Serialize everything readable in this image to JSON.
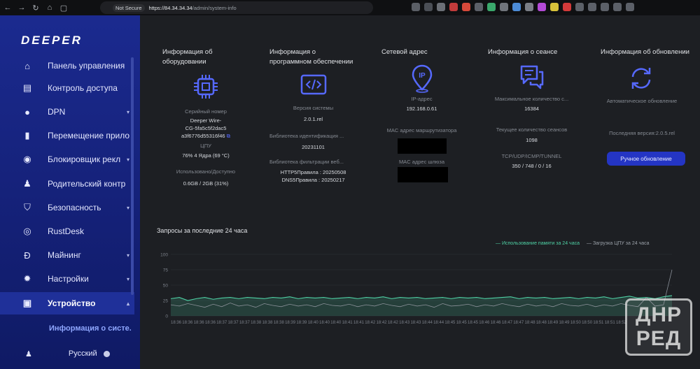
{
  "browser": {
    "security_label": "Not Secure",
    "url_host": "https://84.34.34.34",
    "url_path": "/admin/system-info"
  },
  "sidebar": {
    "logo": "DEEPER",
    "items": [
      {
        "label": "Панель управления",
        "icon": "home-icon"
      },
      {
        "label": "Контроль доступа",
        "icon": "access-control-icon"
      },
      {
        "label": "DPN",
        "icon": "globe-icon"
      },
      {
        "label": "Перемещение прило",
        "icon": "unlock-icon"
      },
      {
        "label": "Блокировщик рекл",
        "icon": "ad-block-icon"
      },
      {
        "label": "Родительский контр",
        "icon": "parental-control-icon"
      },
      {
        "label": "Безопасность",
        "icon": "shield-icon"
      },
      {
        "label": "RustDesk",
        "icon": "rustdesk-icon"
      },
      {
        "label": "Майнинг",
        "icon": "mining-icon"
      },
      {
        "label": "Настройки",
        "icon": "gear-icon"
      },
      {
        "label": "Устройство",
        "icon": "device-icon"
      }
    ],
    "submenu_active": "Информация о систе...",
    "language": "Русский"
  },
  "hardware": {
    "title": "Информация об оборудовании",
    "serial_label": "Серийный номер",
    "serial_value_1": "Deeper Wire-",
    "serial_value_2": "CG-5fa5c5f2dac5",
    "serial_value_3": "a3f6776d55316f46",
    "cpu_label": "ЦПУ",
    "cpu_value": "76% 4 Ядра (69 °C)",
    "usage_label": "Использовано/Доступно",
    "usage_value": "0.6GB / 2GB (31%)"
  },
  "software": {
    "title": "Информация о программном обеспечении",
    "version_label": "Версия системы",
    "version_value": "2.0.1.rel",
    "id_lib_label": "Библиотека идентификация ...",
    "id_lib_value": "20231101",
    "filter_lib_label": "Библиотека фильтрации веб...",
    "filter_http": "HTTP5Правила : 20250508",
    "filter_dns": "DNS5Правила : 20250217"
  },
  "network": {
    "title": "Сетевой адрес",
    "ip_label": "IP-адрес",
    "ip_value": "192.168.0.61",
    "router_mac_label": "MAC адрес маршрутизатора",
    "gateway_mac_label": "MAC адрес шлюза"
  },
  "session": {
    "title": "Информация о сеансе",
    "max_label": "Максимальное количество с...",
    "max_value": "16384",
    "current_label": "Текущее количество сеансов",
    "current_value": "1098",
    "proto_label": "TCP/UDP/ICMP/TUNNEL",
    "proto_value": "350 / 748 / 0 / 16"
  },
  "updates": {
    "title": "Информация об обновлении",
    "auto_label": "Автоматическое обновление",
    "latest_label": "Последняя версия:2.0.5.rel",
    "manual_button": "Ручное обновление"
  },
  "chart_data": {
    "type": "line",
    "title": "Запросы за последние 24 часа",
    "series": [
      {
        "name": "Использование памяти за 24 часа",
        "color": "#4fd1a5",
        "values": [
          28,
          30,
          25,
          28,
          30,
          27,
          29,
          30,
          28,
          30,
          29,
          28,
          30,
          29,
          31,
          28,
          30,
          29,
          30,
          28,
          29,
          30,
          28,
          30,
          29,
          31,
          28,
          30,
          29,
          30,
          28,
          29,
          30,
          28,
          30,
          29,
          30,
          28,
          29,
          30,
          31,
          28,
          30,
          29,
          30,
          28,
          29,
          30,
          28,
          30,
          29,
          31,
          28,
          30,
          32,
          29,
          30,
          28,
          31,
          33
        ]
      },
      {
        "name": "Загрузка ЦПУ за 24 часа",
        "color": "#8a9098",
        "values": [
          18,
          16,
          20,
          17,
          14,
          19,
          15,
          21,
          16,
          18,
          14,
          20,
          17,
          15,
          19,
          16,
          18,
          15,
          20,
          17,
          16,
          19,
          15,
          18,
          16,
          20,
          17,
          15,
          19,
          16,
          18,
          14,
          20,
          16,
          17,
          19,
          15,
          18,
          16,
          20,
          17,
          15,
          19,
          16,
          18,
          15,
          20,
          17,
          16,
          19,
          15,
          18,
          16,
          20,
          17,
          15,
          30,
          16,
          18,
          75
        ]
      }
    ],
    "yticks": [
      0,
      25,
      50,
      75,
      100
    ],
    "ytick_labels": [
      "0",
      "25",
      "50",
      "75",
      "100"
    ],
    "ylim": [
      0,
      100
    ],
    "xtick_labels": [
      "18:36",
      "18:36",
      "18:36",
      "18:36",
      "18:37",
      "18:37",
      "18:37",
      "18:38",
      "18:38",
      "18:38",
      "18:39",
      "18:39",
      "18:40",
      "18:40",
      "18:40",
      "18:41",
      "18:41",
      "18:42",
      "18:42",
      "18:42",
      "18:43",
      "18:43",
      "18:44",
      "18:44",
      "18:45",
      "18:45",
      "18:45",
      "18:46",
      "18:46",
      "18:47",
      "18:47",
      "18:48",
      "18:48",
      "18:49",
      "18:49",
      "18:50",
      "18:50",
      "18:51",
      "18:51",
      "18:52"
    ]
  }
}
